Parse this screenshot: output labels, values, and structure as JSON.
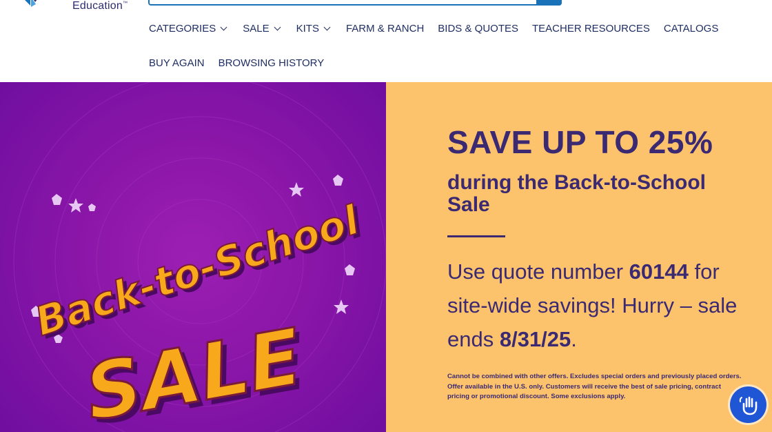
{
  "brand": {
    "logo_text": "Education",
    "logo_suffix": "™"
  },
  "nav": {
    "row1": [
      {
        "label": "CATEGORIES",
        "has_dropdown": true
      },
      {
        "label": "SALE",
        "has_dropdown": true
      },
      {
        "label": "KITS",
        "has_dropdown": true
      },
      {
        "label": "FARM & RANCH",
        "has_dropdown": false
      },
      {
        "label": "BIDS & QUOTES",
        "has_dropdown": false
      },
      {
        "label": "TEACHER RESOURCES",
        "has_dropdown": false
      },
      {
        "label": "CATALOGS",
        "has_dropdown": false
      }
    ],
    "row2": [
      {
        "label": "BUY AGAIN"
      },
      {
        "label": "BROWSING HISTORY"
      }
    ]
  },
  "hero": {
    "art_line1": "Back-to-School",
    "art_line2": "SALE",
    "headline": "SAVE UP TO 25%",
    "subhead": "during the Back-to-School Sale",
    "body_prefix": "Use quote number ",
    "quote_number": "60144",
    "body_middle": " for site-wide savings! Hurry – sale ends ",
    "end_date": "8/31/25",
    "body_suffix": ".",
    "fine_print": "Cannot be combined with other offers. Excludes special orders and previously placed orders. Offer available in the U.S. only. Customers will receive the best of sale pricing, contract pricing or promotional discount. Some exclusions apply."
  },
  "colors": {
    "nav_text": "#1f2e63",
    "hero_left_bg": "#8a16a8",
    "hero_right_bg": "#fdc36c",
    "hero_text": "#3b2a72",
    "art_fill": "#f7a81b",
    "help_button": "#1f56d6"
  },
  "icons": {
    "help": "waving-hand-icon",
    "logo": "logo-mark-icon",
    "dropdown": "chevron-down-icon"
  }
}
